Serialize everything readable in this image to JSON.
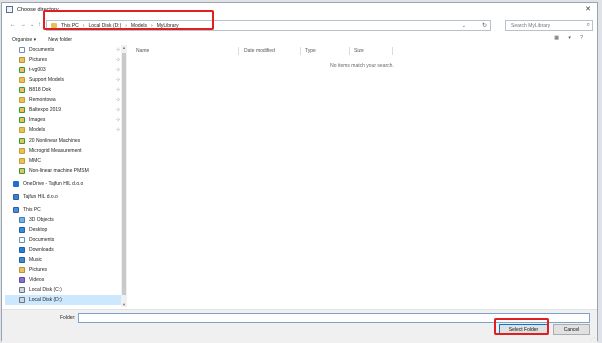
{
  "window": {
    "title": "Choose directory",
    "close": "✕"
  },
  "nav_buttons": {
    "back": "←",
    "forward": "→",
    "recent": "⌄",
    "up": "↑"
  },
  "breadcrumb": [
    "This PC",
    "Local Disk (D:)",
    "Models",
    "MyLibrary"
  ],
  "breadcrumb_separator": "›",
  "address_dropdown": "⌄",
  "refresh": "↻",
  "search": {
    "placeholder": "Search MyLibrary",
    "icon": "⌕"
  },
  "toolbar": {
    "organise": "Organise ▾",
    "new_folder": "New folder",
    "view": "▦ ▾ ?"
  },
  "sidebar": {
    "items": [
      {
        "label": "Documents",
        "icon": "documents-icon",
        "pinned": true
      },
      {
        "label": "Pictures",
        "icon": "pictures-icon",
        "pinned": true
      },
      {
        "label": "t-vg003",
        "icon": "sync-folder-icon",
        "pinned": true
      },
      {
        "label": "Support Models",
        "icon": "folder-icon",
        "pinned": true
      },
      {
        "label": "B818 Dok",
        "icon": "sync-folder-icon",
        "pinned": true
      },
      {
        "label": "Remontowa",
        "icon": "folder-icon",
        "pinned": true
      },
      {
        "label": "Baltexpo 2019",
        "icon": "sync-folder-icon",
        "pinned": true
      },
      {
        "label": "Images",
        "icon": "sync-folder-icon",
        "pinned": true
      },
      {
        "label": "Models",
        "icon": "folder-icon",
        "pinned": true
      },
      {
        "label": "20 Nonlinear Machines",
        "icon": "sync-folder-icon",
        "pinned": false
      },
      {
        "label": "Microgrid Measurement",
        "icon": "folder-icon",
        "pinned": false
      },
      {
        "label": "MMC",
        "icon": "folder-icon",
        "pinned": false
      },
      {
        "label": "Non-linear machine PMSM",
        "icon": "sync-folder-icon",
        "pinned": false
      },
      {
        "label": "OneDrive - Tajfun HIL d.o.o",
        "icon": "onedrive-icon",
        "pinned": false
      },
      {
        "label": "Tajfun HIL d.o.o",
        "icon": "building-icon",
        "pinned": false
      },
      {
        "label": "This PC",
        "icon": "computer-icon",
        "pinned": false
      },
      {
        "label": "3D Objects",
        "icon": "cube-icon",
        "pinned": false
      },
      {
        "label": "Desktop",
        "icon": "desktop-icon",
        "pinned": false
      },
      {
        "label": "Documents",
        "icon": "documents-icon",
        "pinned": false
      },
      {
        "label": "Downloads",
        "icon": "download-icon",
        "pinned": false
      },
      {
        "label": "Music",
        "icon": "music-icon",
        "pinned": false
      },
      {
        "label": "Pictures",
        "icon": "pictures-icon",
        "pinned": false
      },
      {
        "label": "Videos",
        "icon": "videos-icon",
        "pinned": false
      },
      {
        "label": "Local Disk (C:)",
        "icon": "drive-icon",
        "pinned": false
      },
      {
        "label": "Local Disk (D:)",
        "icon": "drive-icon",
        "pinned": false,
        "selected": true
      }
    ],
    "pin_glyph": "📌"
  },
  "columns": {
    "name": "Name",
    "date": "Date modified",
    "type": "Type",
    "size": "Size"
  },
  "empty_message": "No items match your search.",
  "footer": {
    "folder_label": "Folder:",
    "folder_value": "",
    "select_button": "Select Folder",
    "cancel_button": "Cancel"
  },
  "colors": {
    "accent": "#0078d7",
    "highlight": "#e02020",
    "selection": "#cce8ff"
  }
}
